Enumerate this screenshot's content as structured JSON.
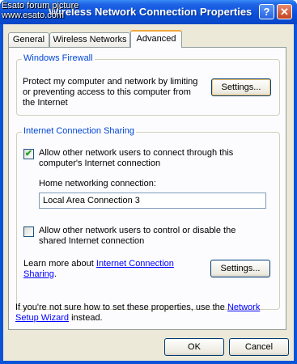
{
  "window": {
    "title": "Wireless Network Connection Properties",
    "watermark": [
      "Esato forum picture",
      "www.esato.com"
    ],
    "help_button": "?",
    "close_button": "✕"
  },
  "tabs": [
    {
      "label": "General"
    },
    {
      "label": "Wireless Networks"
    },
    {
      "label": "Advanced",
      "selected": true
    }
  ],
  "firewall": {
    "title": "Windows Firewall",
    "description": "Protect my computer and network by limiting or preventing access to this computer from the Internet",
    "settings_button": "Settings..."
  },
  "ics": {
    "title": "Internet Connection Sharing",
    "allow_connect": {
      "label": "Allow other network users to connect through this computer's Internet connection",
      "checked": true
    },
    "home_connection_label": "Home networking connection:",
    "home_connection_value": "Local Area Connection 3",
    "allow_control": {
      "label": "Allow other network users to control or disable the shared Internet connection",
      "checked": false
    },
    "learn_more_prefix": "Learn more about ",
    "learn_more_link": "Internet Connection Sharing",
    "learn_more_suffix": ".",
    "settings_button": "Settings..."
  },
  "footer": {
    "text_prefix": "If you're not sure how to set these properties, use the ",
    "wizard_link": "Network Setup Wizard",
    "text_suffix": " instead."
  },
  "buttons": {
    "ok": "OK",
    "cancel": "Cancel"
  },
  "colors": {
    "titlebar": "#0a54d8",
    "dialog_bg": "#ece9d8",
    "group_title": "#0046d5",
    "link": "#0000ff",
    "selected_tab_accent": "#f1a73b"
  }
}
